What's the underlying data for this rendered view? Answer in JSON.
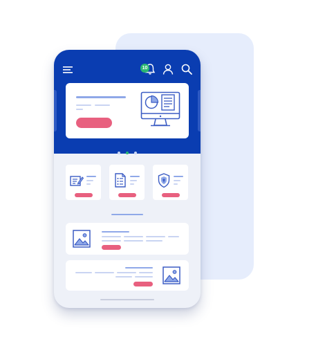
{
  "notification_count": "10",
  "icons": [
    "menu-icon",
    "bell-icon",
    "user-icon",
    "search-icon",
    "monitor-chart-icon",
    "edit-document-icon",
    "document-icon",
    "shield-icon",
    "image-icon"
  ],
  "colors": {
    "primary": "#0a3db1",
    "accent_pink": "#e8607f",
    "badge_green": "#2bb673",
    "line_blue": "#8fa8e8",
    "backdrop": "#e6edfc"
  },
  "carousel": {
    "total": 3,
    "active": 2
  },
  "tiles": [
    {
      "icon": "edit-document-icon"
    },
    {
      "icon": "document-icon"
    },
    {
      "icon": "shield-icon"
    }
  ],
  "list_cards": [
    {
      "icon": "image-icon",
      "icon_side": "left"
    },
    {
      "icon": "image-icon",
      "icon_side": "right"
    }
  ]
}
